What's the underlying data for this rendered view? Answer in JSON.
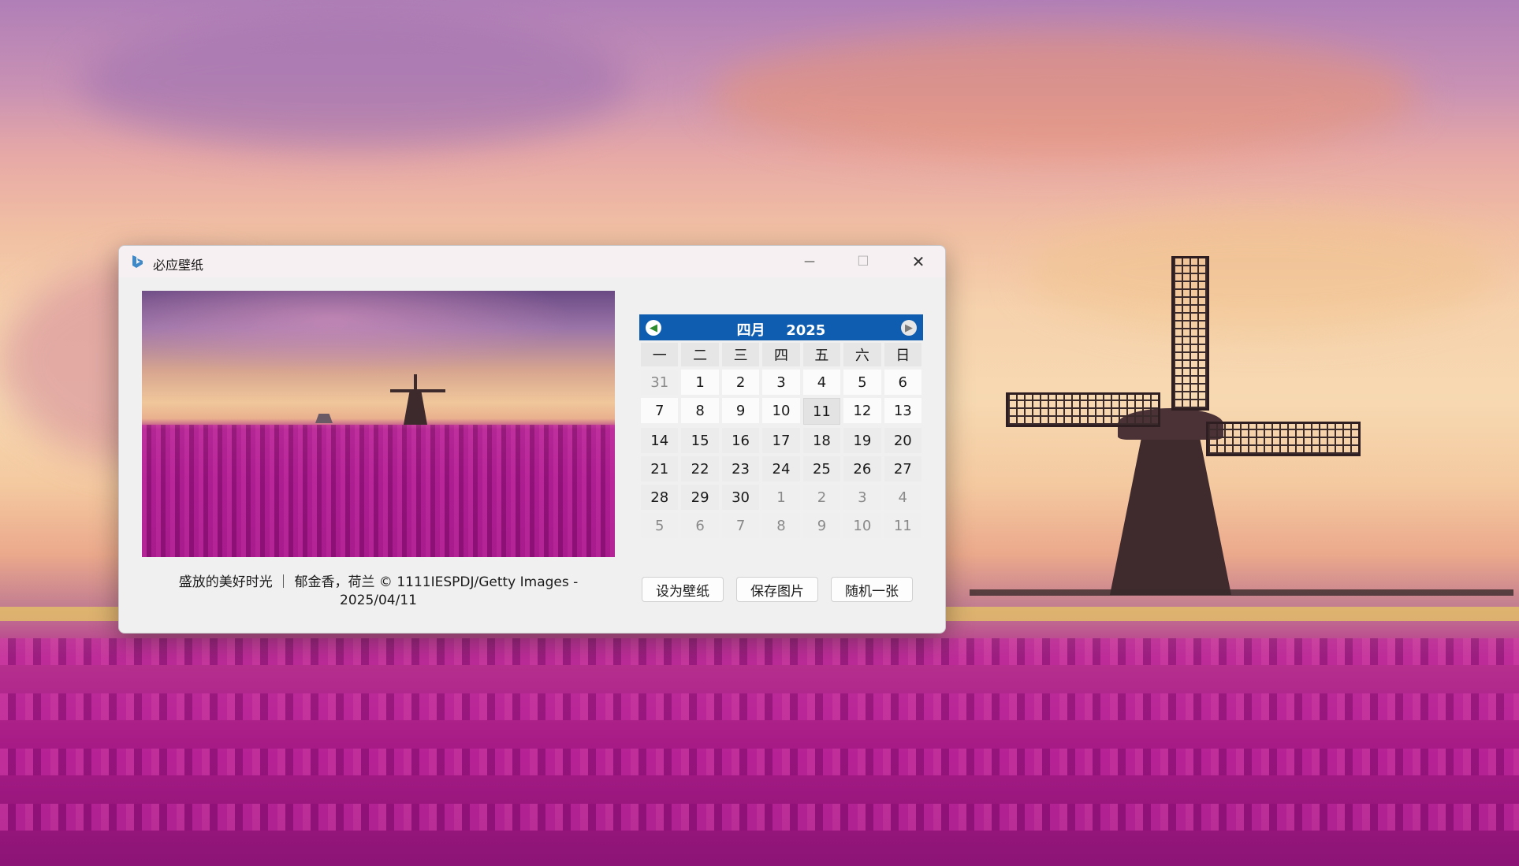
{
  "window": {
    "title": "必应壁纸",
    "controls": {
      "minimize": "—",
      "maximize": "☐",
      "close": "✕"
    }
  },
  "photo": {
    "caption": "盛放的美好时光 ｜ 郁金香，荷兰 © 1111IESPDJ/Getty Images  -  2025/04/11"
  },
  "calendar": {
    "month": "四月",
    "year": "2025",
    "prev_icon": "arrow-left-icon",
    "next_icon": "arrow-right-icon",
    "weekdays": [
      "一",
      "二",
      "三",
      "四",
      "五",
      "六",
      "日"
    ],
    "days": [
      {
        "d": "31",
        "m": "other"
      },
      {
        "d": "1",
        "m": "cur"
      },
      {
        "d": "2",
        "m": "cur"
      },
      {
        "d": "3",
        "m": "cur"
      },
      {
        "d": "4",
        "m": "cur"
      },
      {
        "d": "5",
        "m": "cur"
      },
      {
        "d": "6",
        "m": "cur"
      },
      {
        "d": "7",
        "m": "cur"
      },
      {
        "d": "8",
        "m": "cur"
      },
      {
        "d": "9",
        "m": "cur"
      },
      {
        "d": "10",
        "m": "cur"
      },
      {
        "d": "11",
        "m": "today"
      },
      {
        "d": "12",
        "m": "cur"
      },
      {
        "d": "13",
        "m": "cur"
      },
      {
        "d": "14",
        "m": "plain"
      },
      {
        "d": "15",
        "m": "plain"
      },
      {
        "d": "16",
        "m": "plain"
      },
      {
        "d": "17",
        "m": "plain"
      },
      {
        "d": "18",
        "m": "plain"
      },
      {
        "d": "19",
        "m": "plain"
      },
      {
        "d": "20",
        "m": "plain"
      },
      {
        "d": "21",
        "m": "plain"
      },
      {
        "d": "22",
        "m": "plain"
      },
      {
        "d": "23",
        "m": "plain"
      },
      {
        "d": "24",
        "m": "plain"
      },
      {
        "d": "25",
        "m": "plain"
      },
      {
        "d": "26",
        "m": "plain"
      },
      {
        "d": "27",
        "m": "plain"
      },
      {
        "d": "28",
        "m": "plain"
      },
      {
        "d": "29",
        "m": "plain"
      },
      {
        "d": "30",
        "m": "plain"
      },
      {
        "d": "1",
        "m": "other"
      },
      {
        "d": "2",
        "m": "other"
      },
      {
        "d": "3",
        "m": "other"
      },
      {
        "d": "4",
        "m": "other"
      },
      {
        "d": "5",
        "m": "other"
      },
      {
        "d": "6",
        "m": "other"
      },
      {
        "d": "7",
        "m": "other"
      },
      {
        "d": "8",
        "m": "other"
      },
      {
        "d": "9",
        "m": "other"
      },
      {
        "d": "10",
        "m": "other"
      },
      {
        "d": "11",
        "m": "other"
      }
    ]
  },
  "buttons": {
    "set_wallpaper": "设为壁纸",
    "save_image": "保存图片",
    "random": "随机一张"
  },
  "colors": {
    "calendar_header": "#0e5db0",
    "prev_arrow": "#2f8b2f"
  }
}
